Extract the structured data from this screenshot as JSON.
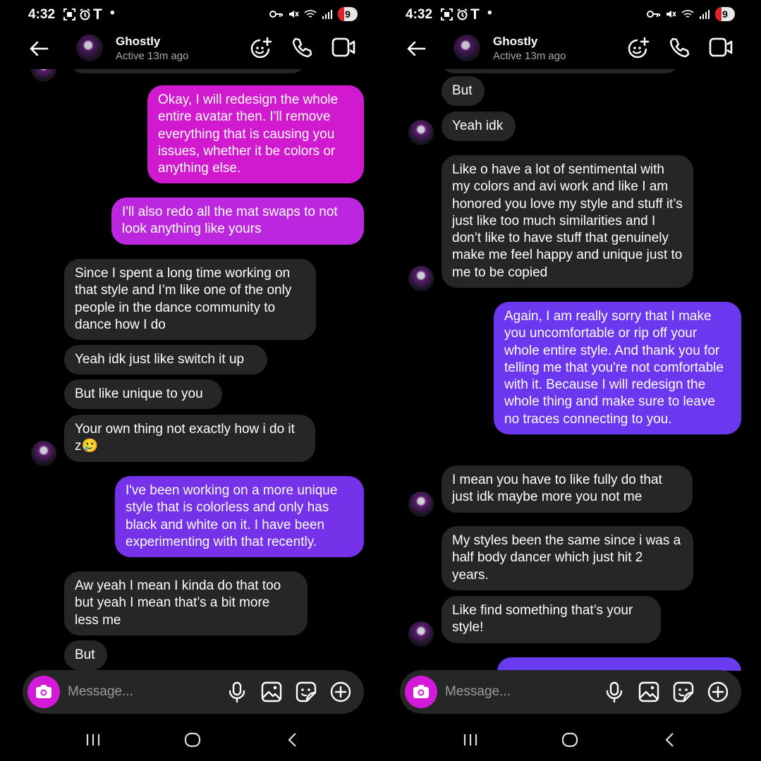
{
  "status": {
    "time": "4:32",
    "carrier_glyph": "T",
    "dot": "•",
    "battery": "9"
  },
  "header": {
    "name": "Ghostly",
    "active": "Active 13m ago"
  },
  "composer": {
    "placeholder": "Message..."
  },
  "colors": {
    "incoming": "#262626",
    "outgoing_pink": "#d11ad0",
    "outgoing_purple": "#7532e8",
    "outgoing_blue": "#6a3cf0",
    "accent": "#d21ad8"
  },
  "icons": [
    "back-arrow-icon",
    "add-friend-icon",
    "phone-icon",
    "video-icon",
    "camera-icon",
    "mic-icon",
    "image-icon",
    "sticker-icon",
    "plus-circle-icon",
    "nav-recents-icon",
    "nav-home-icon",
    "nav-back-icon"
  ],
  "left": {
    "messages": [
      {
        "text": "Okay, I will redesign the whole entire avatar then. I'll remove everything that is causing you issues, whether it be colors or anything else."
      },
      {
        "text": "I'll also redo all the mat swaps to not look anything like yours"
      },
      {
        "text": "Since I spent a long time working on that style and I’m like one of the only people in the dance community to dance how I do"
      },
      {
        "text": "Yeah idk just like switch it up"
      },
      {
        "text": "But like unique to you"
      },
      {
        "text": "Your own thing not exactly how i do it z🥲"
      },
      {
        "text": "I've been working on a more unique style that is colorless and only has black and white on it. I have been experimenting with that recently."
      },
      {
        "text": "Aw yeah I mean I kinda do that too but yeah I mean that’s a bit more less me"
      },
      {
        "text": "But"
      }
    ]
  },
  "right": {
    "messages": [
      {
        "text": "But"
      },
      {
        "text": "Yeah idk"
      },
      {
        "text": "Like o have a lot of sentimental with my colors and avi work and like I am honored you love my style and stuff it’s just like too much similarities and I don’t like to have stuff that genuinely make me feel happy and unique just to me to be copied"
      },
      {
        "text": "Again, I am really sorry that I make you uncomfortable or rip off your whole entire style. And thank you for telling me that you're not comfortable with it. Because I will redesign the whole thing and make sure to leave no traces connecting to you."
      },
      {
        "text": "I mean you  have to like fully do that just idk maybe more you not me"
      },
      {
        "text": "My styles been the same since i was a half body dancer which just hit 2 years."
      },
      {
        "text": "Like find something that’s your style!"
      }
    ]
  }
}
